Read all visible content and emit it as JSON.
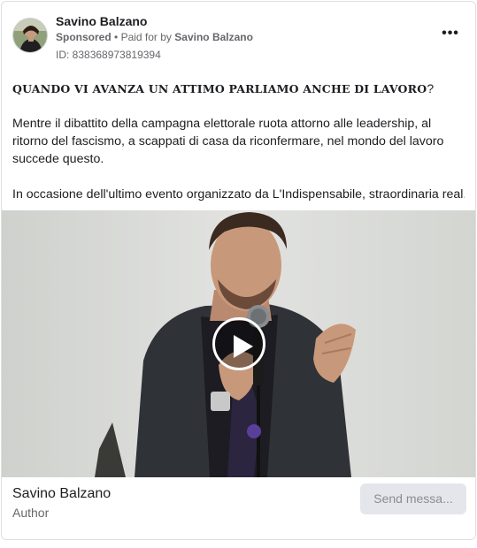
{
  "post": {
    "page_name": "Savino Balzano",
    "sponsored_label": "Sponsored",
    "separator": "•",
    "paid_for_prefix": "Paid for by",
    "paid_for_by": "Savino Balzano",
    "ad_id": "ID: 838368973819394",
    "more_label": "•••",
    "headline": "QUANDO VI AVANZA UN ATTIMO PARLIAMO ANCHE DI LAVORO",
    "headline_mark": "?",
    "paragraph_1": "Mentre il dibattito della campagna elettorale ruota attorno alle leadership, al ritorno del fascismo, a scappati di casa da riconfermare, nel mondo del lavoro succede questo.",
    "paragraph_2": "In occasione dell'ultimo evento organizzato da L'Indispensabile, straordinaria real..."
  },
  "footer": {
    "author_name": "Savino Balzano",
    "author_role": "Author",
    "send_button_label": "Send messa..."
  }
}
